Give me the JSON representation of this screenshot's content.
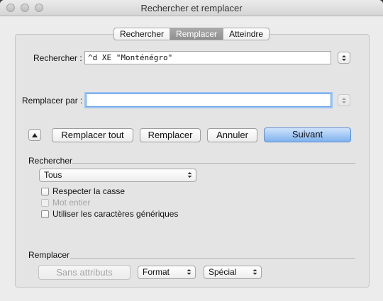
{
  "window": {
    "title": "Rechercher et remplacer"
  },
  "tabs": [
    {
      "label": "Rechercher",
      "active": false
    },
    {
      "label": "Remplacer",
      "active": true
    },
    {
      "label": "Atteindre",
      "active": false
    }
  ],
  "search": {
    "label": "Rechercher :",
    "value": "^d XE \"Monténégro\""
  },
  "replace": {
    "label": "Remplacer par :",
    "value": ""
  },
  "buttons": {
    "replace_all": "Remplacer tout",
    "replace": "Remplacer",
    "cancel": "Annuler",
    "next": "Suivant"
  },
  "find_section": {
    "title": "Rechercher",
    "scope_selected": "Tous",
    "options": [
      {
        "label": "Respecter la casse",
        "checked": false,
        "enabled": true
      },
      {
        "label": "Mot entier",
        "checked": false,
        "enabled": false
      },
      {
        "label": "Utiliser les caractères génériques",
        "checked": false,
        "enabled": true
      }
    ]
  },
  "replace_section": {
    "title": "Remplacer",
    "no_attributes_label": "Sans attributs",
    "format_selected": "Format",
    "special_selected": "Spécial"
  },
  "colors": {
    "default_button": "#7fb2ef",
    "focus_ring": "#9cc4f2"
  }
}
